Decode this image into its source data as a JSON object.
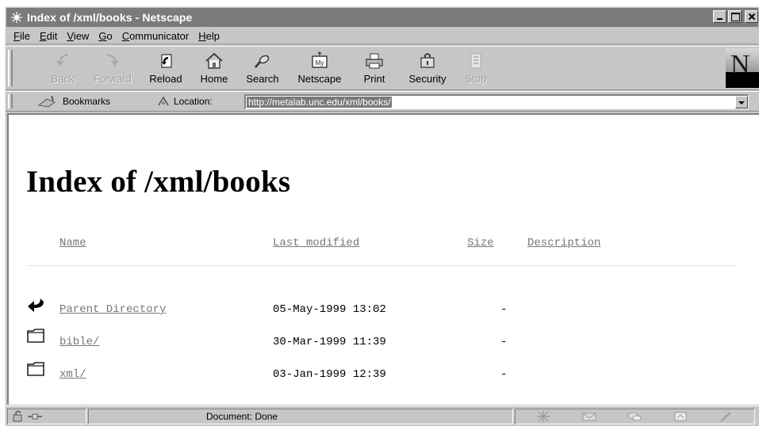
{
  "window": {
    "title": "Index of /xml/books - Netscape"
  },
  "menu": [
    "File",
    "Edit",
    "View",
    "Go",
    "Communicator",
    "Help"
  ],
  "menu_accel": [
    "F",
    "E",
    "V",
    "G",
    "C",
    "H"
  ],
  "toolbar": {
    "buttons": [
      {
        "label": "Back",
        "icon": "back-arrow-icon",
        "enabled": false
      },
      {
        "label": "Forward",
        "icon": "forward-arrow-icon",
        "enabled": false
      },
      {
        "label": "Reload",
        "icon": "reload-icon",
        "enabled": true
      },
      {
        "label": "Home",
        "icon": "home-icon",
        "enabled": true
      },
      {
        "label": "Search",
        "icon": "search-icon",
        "enabled": true
      },
      {
        "label": "Netscape",
        "icon": "netscape-icon",
        "enabled": true
      },
      {
        "label": "Print",
        "icon": "print-icon",
        "enabled": true
      },
      {
        "label": "Security",
        "icon": "security-icon",
        "enabled": true
      },
      {
        "label": "Stop",
        "icon": "stop-icon",
        "enabled": false
      }
    ],
    "logo_letter": "N"
  },
  "location": {
    "bookmarks_label": "Bookmarks",
    "location_label": "Location:",
    "url": "http://metalab.unc.edu/xml/books/"
  },
  "page": {
    "title": "Index of /xml/books",
    "columns": {
      "name": "Name",
      "modified": "Last modified",
      "size": "Size",
      "description": "Description"
    },
    "rows": [
      {
        "name": "Parent Directory",
        "icon": "parent-directory-icon",
        "modified": "05-May-1999 13:02",
        "size": "-"
      },
      {
        "name": "bible/",
        "icon": "folder-icon",
        "modified": "30-Mar-1999 11:39",
        "size": "-"
      },
      {
        "name": "xml/",
        "icon": "folder-icon",
        "modified": "03-Jan-1999 12:39",
        "size": "-"
      }
    ]
  },
  "status": {
    "text": "Document: Done"
  }
}
